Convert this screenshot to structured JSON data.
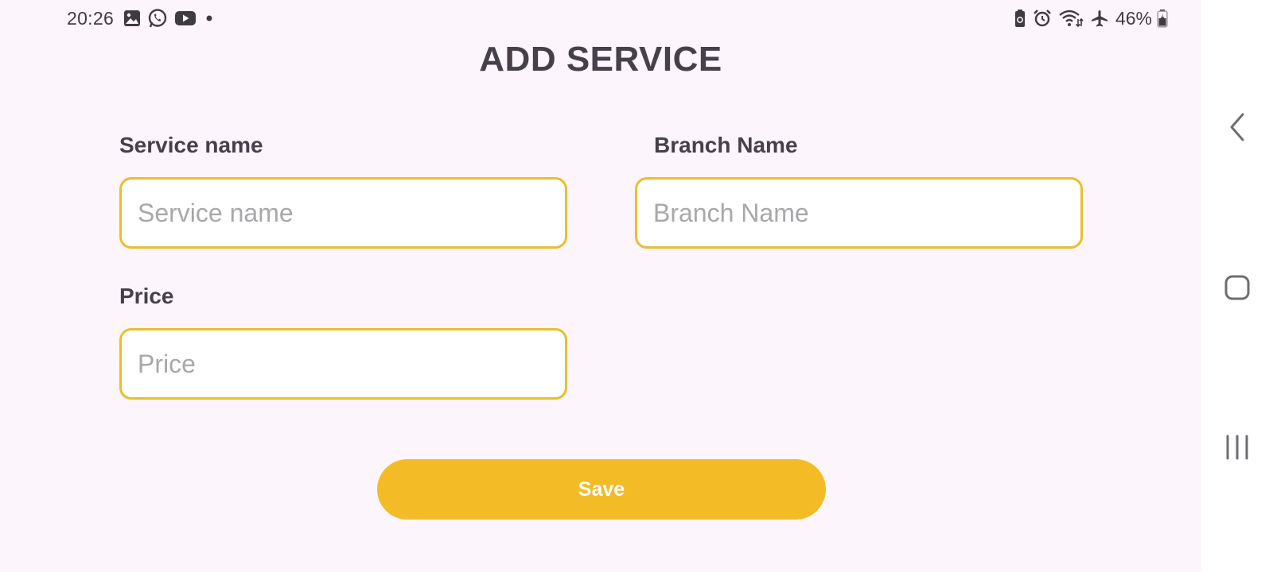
{
  "status_bar": {
    "time": "20:26",
    "left_icons": [
      "gallery-icon",
      "whatsapp-icon",
      "youtube-icon",
      "dot-icon"
    ],
    "right_icons": [
      "battery-saver-icon",
      "alarm-icon",
      "wifi-icon",
      "airplane-icon"
    ],
    "battery_percent": "46%"
  },
  "page": {
    "title": "ADD SERVICE"
  },
  "form": {
    "service_name": {
      "label": "Service name",
      "placeholder": "Service name",
      "value": ""
    },
    "branch_name": {
      "label": "Branch Name",
      "placeholder": "Branch Name",
      "value": ""
    },
    "price": {
      "label": "Price",
      "placeholder": "Price",
      "value": ""
    },
    "save_label": "Save"
  },
  "navigation_bar": {
    "buttons": [
      "back-icon",
      "home-icon",
      "recents-icon"
    ]
  },
  "colors": {
    "background": "#fdf5fc",
    "accent": "#f3bc27",
    "input_border": "#ebbd30",
    "text": "#45414a",
    "placeholder": "#a9a7aa"
  }
}
